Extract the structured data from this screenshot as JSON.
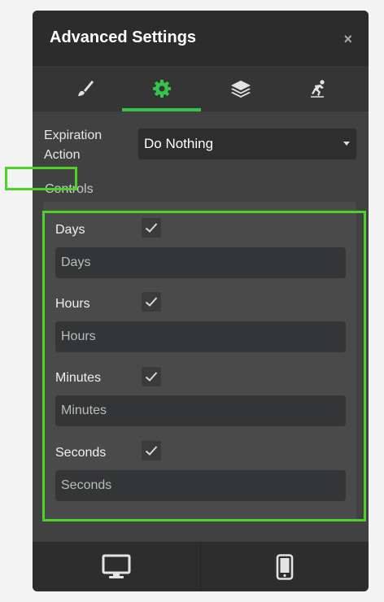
{
  "header": {
    "title": "Advanced Settings",
    "close_glyph": "×"
  },
  "tabs": [
    {
      "icon": "brush-icon"
    },
    {
      "icon": "gear-icon",
      "active": true
    },
    {
      "icon": "layers-icon"
    },
    {
      "icon": "skater-icon"
    }
  ],
  "expiration": {
    "label": "Expiration Action",
    "value": "Do Nothing"
  },
  "controls": {
    "label": "Controls",
    "items": [
      {
        "label": "Days",
        "checked": true,
        "placeholder": "Days"
      },
      {
        "label": "Hours",
        "checked": true,
        "placeholder": "Hours"
      },
      {
        "label": "Minutes",
        "checked": true,
        "placeholder": "Minutes"
      },
      {
        "label": "Seconds",
        "checked": true,
        "placeholder": "Seconds"
      }
    ]
  },
  "footer": {
    "items": [
      {
        "icon": "desktop-icon"
      },
      {
        "icon": "mobile-icon"
      }
    ]
  },
  "colors": {
    "accent": "#36c54b",
    "highlight": "#4ed22a",
    "panel": "#414141"
  }
}
